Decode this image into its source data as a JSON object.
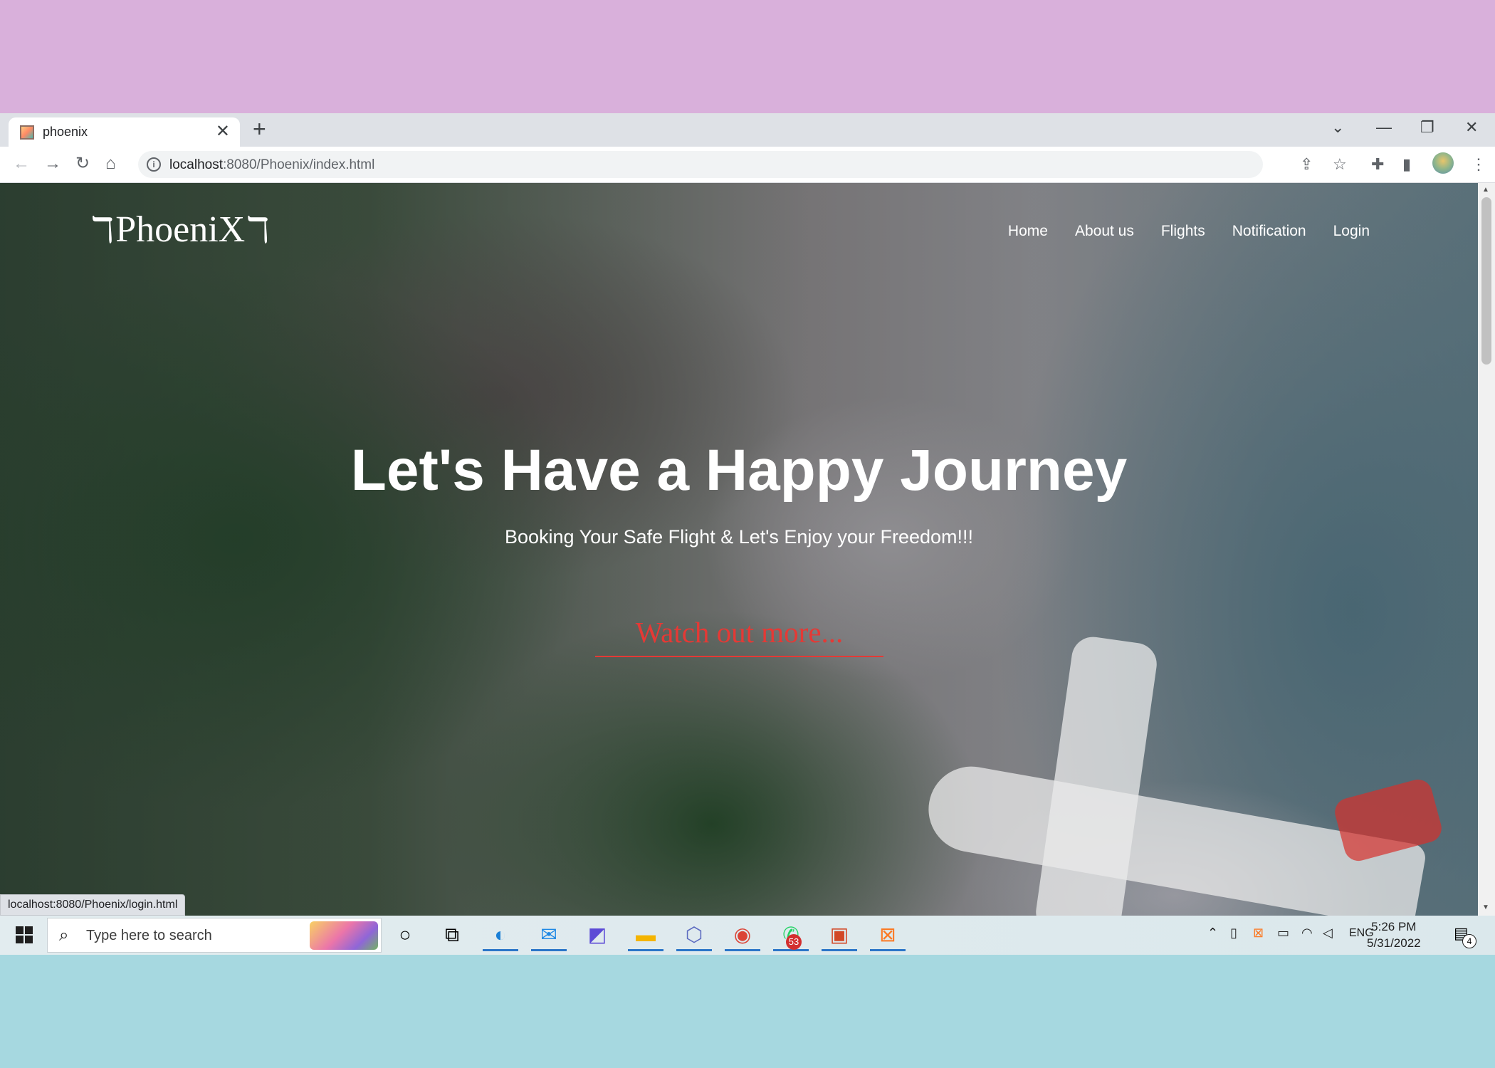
{
  "browser": {
    "tab_title": "phoenix",
    "url_host": "localhost",
    "url_rest": ":8080/Phoenix/index.html",
    "status_url": "localhost:8080/Phoenix/login.html"
  },
  "site": {
    "logo_text": "PhoeniX",
    "nav": [
      "Home",
      "About us",
      "Flights",
      "Notification",
      "Login"
    ],
    "hero_title": "Let's Have a Happy Journey",
    "hero_subtitle": "Booking Your Safe Flight & Let's Enjoy your Freedom!!!",
    "cta_label": "Watch out more..."
  },
  "taskbar": {
    "search_placeholder": "Type here to search",
    "language": "ENG",
    "time": "5:26 PM",
    "date": "5/31/2022",
    "notification_count": "4",
    "whatsapp_badge": "53",
    "apps": [
      "cortana",
      "task-view",
      "edge",
      "mail",
      "app",
      "file-explorer",
      "app-hex",
      "chrome",
      "whatsapp",
      "powerpoint",
      "xampp"
    ]
  },
  "colors": {
    "accent_red": "#e53935",
    "background_top": "#d9b0db",
    "background_bottom": "#a6d8e0"
  }
}
